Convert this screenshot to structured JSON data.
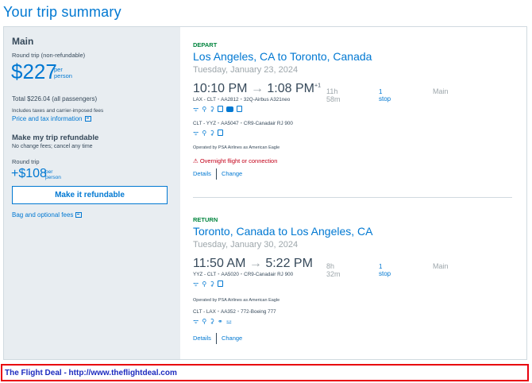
{
  "page": {
    "title": "Your trip summary"
  },
  "fare": {
    "name": "Main",
    "type": "Round trip (non-refundable)",
    "price": "$227",
    "per_line1": "per",
    "per_line2": "person",
    "total": "Total $226.04 (all passengers)",
    "fees_note": "Includes taxes and carrier-imposed fees",
    "price_info_link": "Price and tax information",
    "refund_title": "Make my trip refundable",
    "refund_subtitle": "No change fees; cancel any time",
    "round_trip_label": "Round trip",
    "addon_price": "+$108",
    "addon_per_line1": "per",
    "addon_per_line2": "person",
    "refund_button": "Make it refundable",
    "bag_fees_link": "Bag and optional fees"
  },
  "depart": {
    "label": "DEPART",
    "route": "Los Angeles, CA to Toronto, Canada",
    "date": "Tuesday, January 23, 2024",
    "dep_time": "10:10 PM",
    "arrow": "→",
    "arr_time": "1:08 PM",
    "day_offset": "+1",
    "duration": "11h 58m",
    "stops": "1 stop",
    "cabin": "Main",
    "leg1": {
      "route": "LAX - CLT",
      "flight": "AA2812",
      "aircraft": "32Q-Airbus A321neo"
    },
    "leg2": {
      "route": "CLT - YYZ",
      "flight": "AA5047",
      "aircraft": "CR9-Canadair RJ 900"
    },
    "operated_by": "Operated by PSA Airlines as American Eagle",
    "warning": "Overnight flight or connection",
    "details_link": "Details",
    "change_link": "Change"
  },
  "return": {
    "label": "RETURN",
    "route": "Toronto, Canada to Los Angeles, CA",
    "date": "Tuesday, January 30, 2024",
    "dep_time": "11:50 AM",
    "arrow": "→",
    "arr_time": "5:22 PM",
    "duration": "8h 32m",
    "stops": "1 stop",
    "cabin": "Main",
    "leg1": {
      "route": "YYZ - CLT",
      "flight": "AA5020",
      "aircraft": "CR9-Canadair RJ 900"
    },
    "operated_by": "Operated by PSA Airlines as American Eagle",
    "leg2": {
      "route": "CLT - LAX",
      "flight": "AA352",
      "aircraft": "772-Boeing 777"
    },
    "details_link": "Details",
    "change_link": "Change"
  },
  "footer": {
    "text": "The Flight Deal - http://www.theflightdeal.com"
  },
  "colors": {
    "brand_blue": "#0078d2",
    "depart_green": "#00843d",
    "warning_red": "#c30019",
    "footer_border": "#e8000e"
  },
  "icons": [
    "wifi-icon",
    "power-outlet-icon",
    "usb-icon",
    "seatback-tv-icon",
    "entertainment-icon",
    "app-icon",
    "food-icon",
    "lie-flat-icon",
    "warning-icon",
    "external-link-icon"
  ]
}
